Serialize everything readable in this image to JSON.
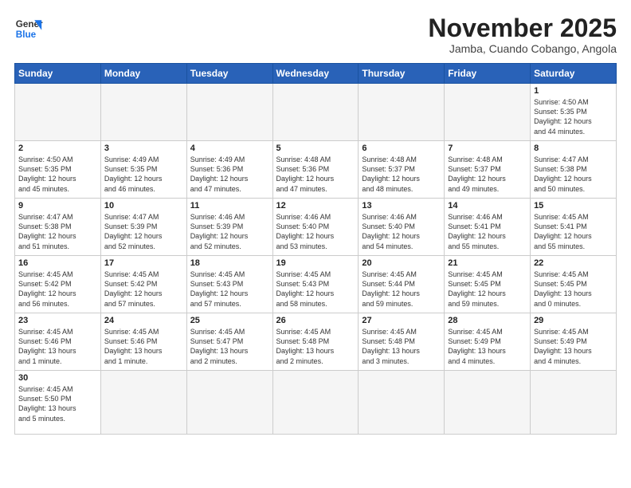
{
  "logo": {
    "line1": "General",
    "line2": "Blue"
  },
  "title": "November 2025",
  "subtitle": "Jamba, Cuando Cobango, Angola",
  "days_header": [
    "Sunday",
    "Monday",
    "Tuesday",
    "Wednesday",
    "Thursday",
    "Friday",
    "Saturday"
  ],
  "weeks": [
    [
      {
        "num": "",
        "detail": ""
      },
      {
        "num": "",
        "detail": ""
      },
      {
        "num": "",
        "detail": ""
      },
      {
        "num": "",
        "detail": ""
      },
      {
        "num": "",
        "detail": ""
      },
      {
        "num": "",
        "detail": ""
      },
      {
        "num": "1",
        "detail": "Sunrise: 4:50 AM\nSunset: 5:35 PM\nDaylight: 12 hours\nand 44 minutes."
      }
    ],
    [
      {
        "num": "2",
        "detail": "Sunrise: 4:50 AM\nSunset: 5:35 PM\nDaylight: 12 hours\nand 45 minutes."
      },
      {
        "num": "3",
        "detail": "Sunrise: 4:49 AM\nSunset: 5:35 PM\nDaylight: 12 hours\nand 46 minutes."
      },
      {
        "num": "4",
        "detail": "Sunrise: 4:49 AM\nSunset: 5:36 PM\nDaylight: 12 hours\nand 47 minutes."
      },
      {
        "num": "5",
        "detail": "Sunrise: 4:48 AM\nSunset: 5:36 PM\nDaylight: 12 hours\nand 47 minutes."
      },
      {
        "num": "6",
        "detail": "Sunrise: 4:48 AM\nSunset: 5:37 PM\nDaylight: 12 hours\nand 48 minutes."
      },
      {
        "num": "7",
        "detail": "Sunrise: 4:48 AM\nSunset: 5:37 PM\nDaylight: 12 hours\nand 49 minutes."
      },
      {
        "num": "8",
        "detail": "Sunrise: 4:47 AM\nSunset: 5:38 PM\nDaylight: 12 hours\nand 50 minutes."
      }
    ],
    [
      {
        "num": "9",
        "detail": "Sunrise: 4:47 AM\nSunset: 5:38 PM\nDaylight: 12 hours\nand 51 minutes."
      },
      {
        "num": "10",
        "detail": "Sunrise: 4:47 AM\nSunset: 5:39 PM\nDaylight: 12 hours\nand 52 minutes."
      },
      {
        "num": "11",
        "detail": "Sunrise: 4:46 AM\nSunset: 5:39 PM\nDaylight: 12 hours\nand 52 minutes."
      },
      {
        "num": "12",
        "detail": "Sunrise: 4:46 AM\nSunset: 5:40 PM\nDaylight: 12 hours\nand 53 minutes."
      },
      {
        "num": "13",
        "detail": "Sunrise: 4:46 AM\nSunset: 5:40 PM\nDaylight: 12 hours\nand 54 minutes."
      },
      {
        "num": "14",
        "detail": "Sunrise: 4:46 AM\nSunset: 5:41 PM\nDaylight: 12 hours\nand 55 minutes."
      },
      {
        "num": "15",
        "detail": "Sunrise: 4:45 AM\nSunset: 5:41 PM\nDaylight: 12 hours\nand 55 minutes."
      }
    ],
    [
      {
        "num": "16",
        "detail": "Sunrise: 4:45 AM\nSunset: 5:42 PM\nDaylight: 12 hours\nand 56 minutes."
      },
      {
        "num": "17",
        "detail": "Sunrise: 4:45 AM\nSunset: 5:42 PM\nDaylight: 12 hours\nand 57 minutes."
      },
      {
        "num": "18",
        "detail": "Sunrise: 4:45 AM\nSunset: 5:43 PM\nDaylight: 12 hours\nand 57 minutes."
      },
      {
        "num": "19",
        "detail": "Sunrise: 4:45 AM\nSunset: 5:43 PM\nDaylight: 12 hours\nand 58 minutes."
      },
      {
        "num": "20",
        "detail": "Sunrise: 4:45 AM\nSunset: 5:44 PM\nDaylight: 12 hours\nand 59 minutes."
      },
      {
        "num": "21",
        "detail": "Sunrise: 4:45 AM\nSunset: 5:45 PM\nDaylight: 12 hours\nand 59 minutes."
      },
      {
        "num": "22",
        "detail": "Sunrise: 4:45 AM\nSunset: 5:45 PM\nDaylight: 13 hours\nand 0 minutes."
      }
    ],
    [
      {
        "num": "23",
        "detail": "Sunrise: 4:45 AM\nSunset: 5:46 PM\nDaylight: 13 hours\nand 1 minute."
      },
      {
        "num": "24",
        "detail": "Sunrise: 4:45 AM\nSunset: 5:46 PM\nDaylight: 13 hours\nand 1 minute."
      },
      {
        "num": "25",
        "detail": "Sunrise: 4:45 AM\nSunset: 5:47 PM\nDaylight: 13 hours\nand 2 minutes."
      },
      {
        "num": "26",
        "detail": "Sunrise: 4:45 AM\nSunset: 5:48 PM\nDaylight: 13 hours\nand 2 minutes."
      },
      {
        "num": "27",
        "detail": "Sunrise: 4:45 AM\nSunset: 5:48 PM\nDaylight: 13 hours\nand 3 minutes."
      },
      {
        "num": "28",
        "detail": "Sunrise: 4:45 AM\nSunset: 5:49 PM\nDaylight: 13 hours\nand 4 minutes."
      },
      {
        "num": "29",
        "detail": "Sunrise: 4:45 AM\nSunset: 5:49 PM\nDaylight: 13 hours\nand 4 minutes."
      }
    ],
    [
      {
        "num": "30",
        "detail": "Sunrise: 4:45 AM\nSunset: 5:50 PM\nDaylight: 13 hours\nand 5 minutes."
      },
      {
        "num": "",
        "detail": ""
      },
      {
        "num": "",
        "detail": ""
      },
      {
        "num": "",
        "detail": ""
      },
      {
        "num": "",
        "detail": ""
      },
      {
        "num": "",
        "detail": ""
      },
      {
        "num": "",
        "detail": ""
      }
    ]
  ]
}
